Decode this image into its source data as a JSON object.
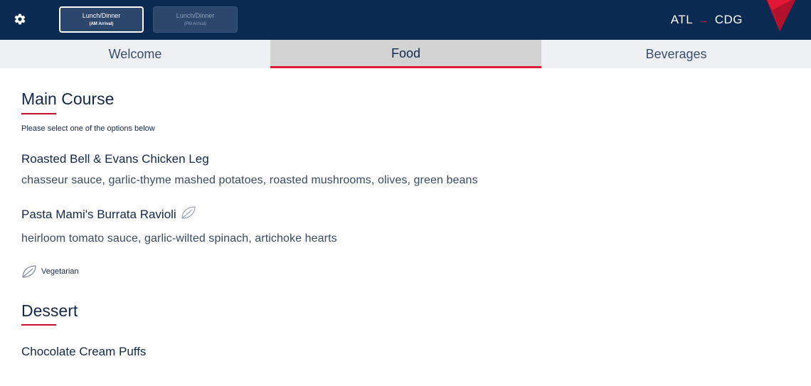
{
  "header": {
    "settings_icon": "gear-icon",
    "meal_options": [
      {
        "label": "Lunch/Dinner",
        "sublabel": "(AM Arrival)",
        "selected": true
      },
      {
        "label": "Lunch/Dinner",
        "sublabel": "(PM Arrival)",
        "selected": false
      }
    ],
    "route": {
      "origin": "ATL",
      "arrow": "→",
      "destination": "CDG"
    },
    "logo_icon": "airline-logo-icon"
  },
  "tabs": [
    {
      "label": "Welcome",
      "active": false
    },
    {
      "label": "Food",
      "active": true
    },
    {
      "label": "Beverages",
      "active": false
    }
  ],
  "main_course": {
    "title": "Main Course",
    "instruction": "Please select one of the options below",
    "dishes": [
      {
        "name": "Roasted Bell & Evans Chicken Leg",
        "description": "chasseur sauce, garlic-thyme mashed potatoes, roasted mushrooms, olives, green beans",
        "vegetarian": false
      },
      {
        "name": "Pasta Mami's Burrata Ravioli",
        "description": "heirloom tomato sauce, garlic-wilted spinach, artichoke hearts",
        "vegetarian": true
      }
    ],
    "legend": {
      "icon": "leaf-icon",
      "label": "Vegetarian"
    }
  },
  "dessert": {
    "title": "Dessert",
    "dishes": [
      {
        "name": "Chocolate Cream Puffs"
      }
    ]
  },
  "colors": {
    "header_bg": "#0b2a52",
    "accent_red": "#e31837",
    "text_navy": "#14284b",
    "tab_bg": "#eef0f3",
    "tab_active_bg": "#d3d3d3"
  }
}
